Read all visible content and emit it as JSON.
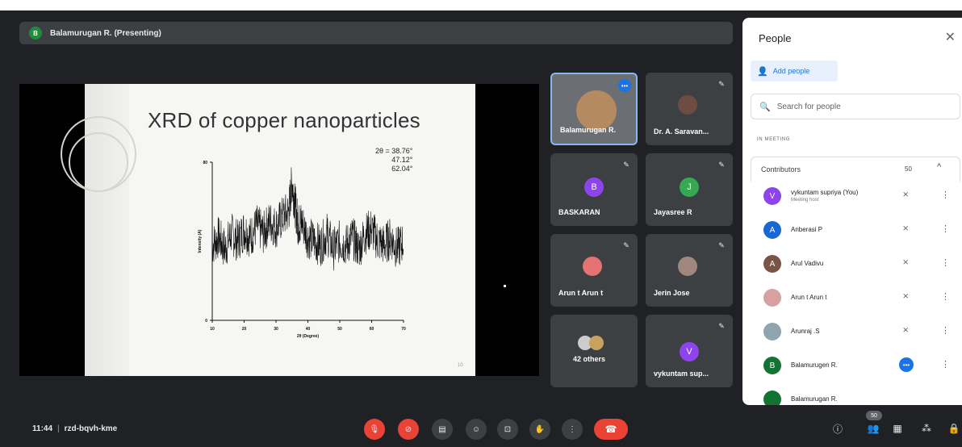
{
  "meeting": {
    "presenter_banner": "Balamurugan R. (Presenting)",
    "presenter_initial": "B",
    "time": "11:44",
    "code": "rzd-bqvh-kme"
  },
  "slide": {
    "title": "XRD of copper nanoparticles",
    "peaks": [
      "2θ = 38.76°",
      "47.12°",
      "62.04°"
    ],
    "slide_number": "10",
    "chart_data": {
      "type": "line",
      "title": "",
      "xlabel": "2θ (Degree)",
      "ylabel": "Intensity (A)",
      "xlim": [
        10,
        70
      ],
      "x_ticks": [
        "10",
        "20",
        "30",
        "40",
        "50",
        "60",
        "70"
      ],
      "y_ticks": [
        "0",
        "80"
      ],
      "series": [
        {
          "x": [
            10,
            12,
            14,
            16,
            18,
            20,
            22,
            24,
            26,
            28,
            30,
            32,
            34,
            35,
            36,
            37,
            38,
            40,
            42,
            44,
            46,
            48,
            50,
            52,
            54,
            56,
            58,
            60,
            62,
            64,
            66,
            68,
            70
          ],
          "y": [
            38,
            42,
            36,
            44,
            40,
            46,
            42,
            48,
            44,
            50,
            47,
            52,
            55,
            70,
            58,
            48,
            50,
            42,
            40,
            38,
            44,
            36,
            40,
            38,
            42,
            36,
            44,
            46,
            40,
            38,
            42,
            36,
            40
          ]
        }
      ]
    }
  },
  "tiles": [
    {
      "name": "Balamurugan R.",
      "kind": "video"
    },
    {
      "name": "Dr. A. Saravan...",
      "kind": "photo"
    },
    {
      "name": "BASKARAN",
      "initial": "B",
      "color": "#8e44ec"
    },
    {
      "name": "Jayasree R",
      "initial": "J",
      "color": "#34a853"
    },
    {
      "name": "Arun t Arun t",
      "kind": "photo"
    },
    {
      "name": "Jerin Jose",
      "kind": "photo"
    },
    {
      "name": "42 others",
      "kind": "group"
    },
    {
      "name": "vykuntam sup...",
      "initial": "V",
      "color": "#8e44ec"
    }
  ],
  "panel": {
    "title": "People",
    "add_people": "Add people",
    "search_placeholder": "Search for people",
    "section": "IN MEETING",
    "contributors_label": "Contributors",
    "contributors_count": "50",
    "people": [
      {
        "name": "vykuntam supriya (You)",
        "sub": "Meeting host",
        "initial": "V",
        "color": "#8e44ec"
      },
      {
        "name": "Anberasi P",
        "initial": "A",
        "color": "#1967d2"
      },
      {
        "name": "Arul Vadivu",
        "initial": "A",
        "color": "#795548"
      },
      {
        "name": "Arun t Arun t",
        "initial": "",
        "color": "#d8a0a0"
      },
      {
        "name": "Arunraj .S",
        "initial": "",
        "color": "#9ab"
      },
      {
        "name": "Balamurugen R.",
        "initial": "B",
        "color": "#137333"
      },
      {
        "name": "Balamurugan R.",
        "initial": "",
        "color": "#137333"
      }
    ]
  },
  "controls": {
    "participants_badge": "50"
  }
}
